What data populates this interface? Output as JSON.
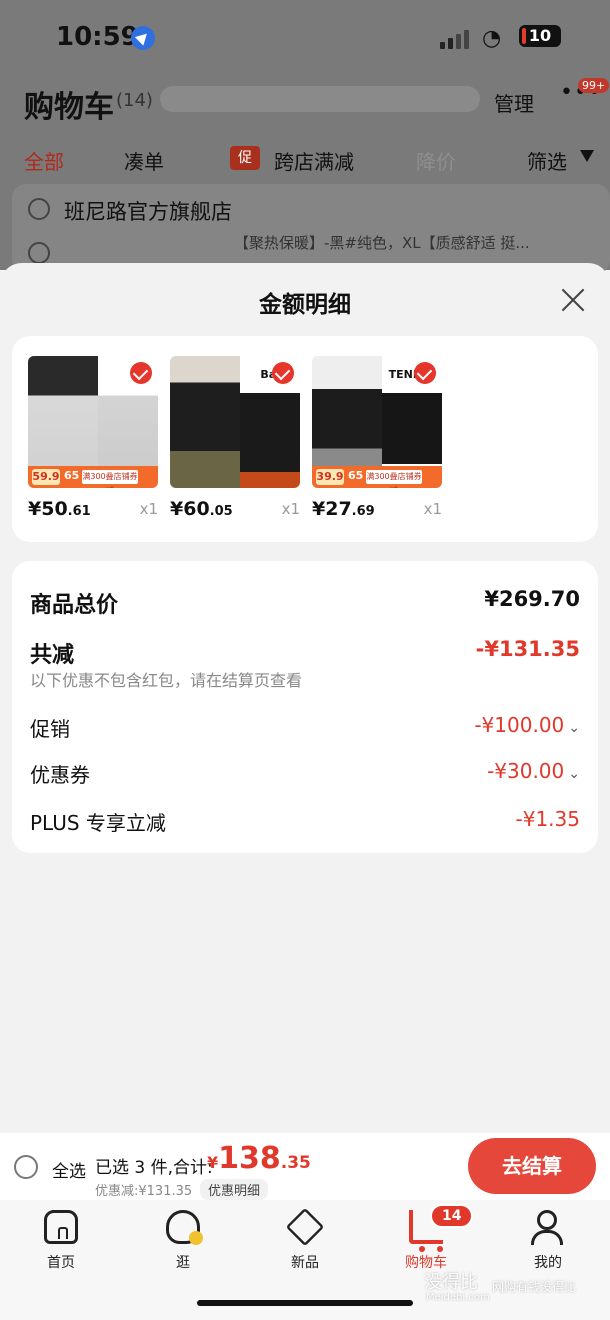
{
  "status_bar": {
    "time": "10:59",
    "battery": "10"
  },
  "background": {
    "title": "购物车",
    "count": "(14)",
    "manage": "管理",
    "more_badge": "99+",
    "tabs": [
      "全部",
      "凑单",
      "跨店满减",
      "降价",
      "筛选"
    ],
    "promo_tag": "促",
    "store_name": "班尼路官方旗舰店",
    "item_desc": "【聚热保暖】-黑#纯色，XL【质感舒适 挺..."
  },
  "sheet": {
    "title": "金额明细",
    "products": [
      {
        "brand": "",
        "badge_old": "59.9",
        "badge_new": "65",
        "badge_note": "满300叠店铺券减",
        "price_int": "¥50",
        "price_dec": ".61",
        "qty": "x1"
      },
      {
        "brand": "Bal",
        "badge_old": "",
        "badge_new": "",
        "badge_note": "",
        "price_int": "¥60",
        "price_dec": ".05",
        "qty": "x1"
      },
      {
        "brand": "TEND",
        "badge_old": "39.9",
        "badge_new": "65",
        "badge_note": "满300叠店铺券减",
        "price_int": "¥27",
        "price_dec": ".69",
        "qty": "x1"
      }
    ],
    "summary": {
      "total_label": "商品总价",
      "total_value": "¥269.70",
      "reduce_label": "共减",
      "reduce_value": "-¥131.35",
      "reduce_note": "以下优惠不包含红包，请在结算页查看",
      "promo_label": "促销",
      "promo_value": "-¥100.00",
      "coupon_label": "优惠券",
      "coupon_value": "-¥30.00",
      "plus_label": "PLUS 专享立减",
      "plus_value": "-¥1.35"
    }
  },
  "checkout": {
    "select_all": "全选",
    "selected": "已选 3 件,合计:",
    "currency": "¥",
    "total_int": "138",
    "total_dec": ".35",
    "saved": "优惠减:¥131.35",
    "detail": "优惠明细",
    "go": "去结算"
  },
  "tabbar": {
    "items": [
      "首页",
      "逛",
      "新品",
      "购物车",
      "我的"
    ],
    "cart_badge": "14"
  },
  "watermark": {
    "main": "没得比",
    "sub": "网购有钱没得比",
    "url": "Meidebi.com"
  },
  "colors": {
    "accent": "#e0392b",
    "checkout_button": "#e5473a"
  }
}
